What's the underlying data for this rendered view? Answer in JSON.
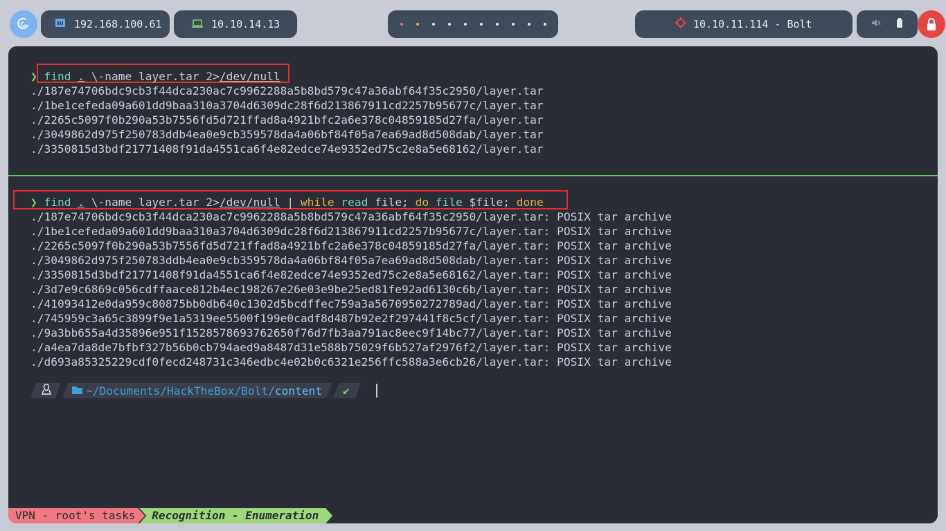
{
  "topbar": {
    "logo_icon": "debian-swirl-icon",
    "local_ip": "192.168.100.61",
    "vpn_ip": "10.10.14.13",
    "workspaces": [
      {
        "color": "#e06c75"
      },
      {
        "color": "#e3b341"
      },
      {
        "color": "#e6e9ef"
      },
      {
        "color": "#e6e9ef"
      },
      {
        "color": "#e6e9ef"
      },
      {
        "color": "#e6e9ef"
      },
      {
        "color": "#e6e9ef"
      },
      {
        "color": "#e6e9ef"
      },
      {
        "color": "#e6e9ef"
      },
      {
        "color": "#e6e9ef"
      }
    ],
    "target": "10.10.11.114 - Bolt",
    "sys_icons": [
      "mute-icon",
      "battery-icon"
    ],
    "lock_icon": "lock-icon"
  },
  "terminal": {
    "cmd1": {
      "arrow": "❯",
      "find": "find",
      "dot": ".",
      "args": " \\-name layer.tar 2>",
      "devnull": "/dev/null"
    },
    "output1": [
      "./187e74706bdc9cb3f44dca230ac7c9962288a5b8bd579c47a36abf64f35c2950/layer.tar",
      "./1be1cefeda09a601dd9baa310a3704d6309dc28f6d213867911cd2257b95677c/layer.tar",
      "./2265c5097f0b290a53b7556fd5d721ffad8a4921bfc2a6e378c04859185d27fa/layer.tar",
      "./3049862d975f250783ddb4ea0e9cb359578da4a06bf84f05a7ea69ad8d508dab/layer.tar",
      "./3350815d3bdf21771408f91da4551ca6f4e82edce74e9352ed75c2e8a5e68162/layer.tar"
    ],
    "cmd2": {
      "arrow": "❯",
      "find": "find",
      "dot": ".",
      "args": " \\-name layer.tar 2>",
      "devnull": "/dev/null",
      "pipe": " | ",
      "while": "while",
      "read": " read",
      "file_var": " file; ",
      "do": "do",
      "file_cmd": " file",
      "rest": " $file; ",
      "done": "done"
    },
    "output2": [
      "./187e74706bdc9cb3f44dca230ac7c9962288a5b8bd579c47a36abf64f35c2950/layer.tar: POSIX tar archive",
      "./1be1cefeda09a601dd9baa310a3704d6309dc28f6d213867911cd2257b95677c/layer.tar: POSIX tar archive",
      "./2265c5097f0b290a53b7556fd5d721ffad8a4921bfc2a6e378c04859185d27fa/layer.tar: POSIX tar archive",
      "./3049862d975f250783ddb4ea0e9cb359578da4a06bf84f05a7ea69ad8d508dab/layer.tar: POSIX tar archive",
      "./3350815d3bdf21771408f91da4551ca6f4e82edce74e9352ed75c2e8a5e68162/layer.tar: POSIX tar archive",
      "./3d7e9c6869c056cdffaace812b4ec198267e26e03e9be25ed81fe92ad6130c6b/layer.tar: POSIX tar archive",
      "./41093412e0da959c80875bb0db640c1302d5bcdffec759a3a5670950272789ad/layer.tar: POSIX tar archive",
      "./745959c3a65c3899f9e1a5319ee5500f199e0cadf8d487b92e2f297441f8c5cf/layer.tar: POSIX tar archive",
      "./9a3bb655a4d35896e951f1528578693762650f76d7fb3aa791ac8eec9f14bc77/layer.tar: POSIX tar archive",
      "./a4ea7da8de7bfbf327b56b0cb794aed9a8487d31e588b75029f6b527af2976f2/layer.tar: POSIX tar archive",
      "./d693a85325229cdf0fecd248731c346edbc4e02b0c6321e256ffc588a3e6cb26/layer.tar: POSIX tar archive"
    ],
    "prompt": {
      "os_icon": "linux-tux-icon",
      "folder_icon": "folder-open-icon",
      "path_prefix": "~/Documents/HackTheBox/Bolt/",
      "path_last": "content",
      "status": "✔"
    },
    "statusbar": {
      "left": "VPN - root's tasks",
      "right": "Recognition - Enumeration"
    }
  },
  "colors": {
    "terminal_bg": "#2a2c36",
    "highlight": "#e03030",
    "separator": "#62c962"
  }
}
